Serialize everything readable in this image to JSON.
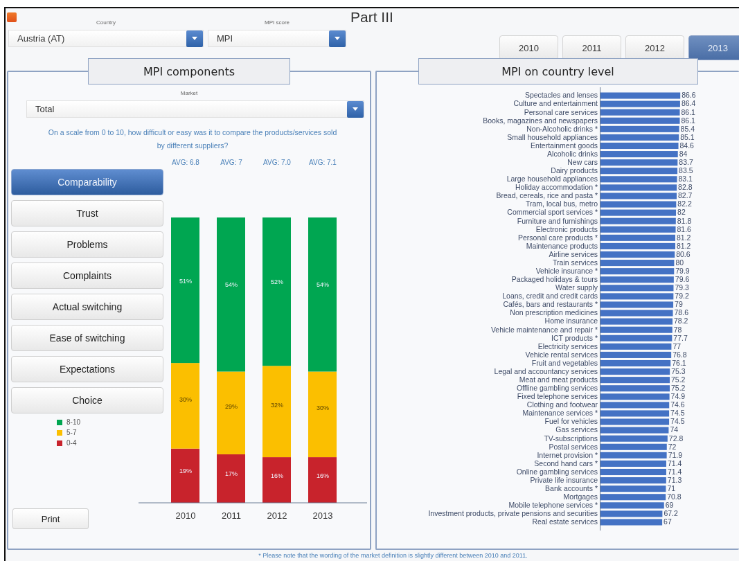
{
  "title": "Part III",
  "filters": [
    {
      "label": "Country",
      "value": "Austria (AT)"
    },
    {
      "label": "MPI score",
      "value": "MPI"
    }
  ],
  "years": [
    {
      "label": "2010",
      "selected": false
    },
    {
      "label": "2011",
      "selected": false
    },
    {
      "label": "2012",
      "selected": false
    },
    {
      "label": "2013",
      "selected": true
    }
  ],
  "components_panel": {
    "heading": "MPI components",
    "market_label": "Market",
    "market_value": "Total",
    "question": "On a scale from 0 to 10, how difficult or easy was it to compare the products/services sold by different suppliers?",
    "averages": [
      "AVG: 6.8",
      "AVG: 7",
      "AVG: 7.0",
      "AVG: 7.1"
    ],
    "components": [
      {
        "label": "Comparability",
        "selected": true
      },
      {
        "label": "Trust",
        "selected": false
      },
      {
        "label": "Problems",
        "selected": false
      },
      {
        "label": "Complaints",
        "selected": false
      },
      {
        "label": "Actual switching",
        "selected": false
      },
      {
        "label": "Ease of switching",
        "selected": false
      },
      {
        "label": "Expectations",
        "selected": false
      },
      {
        "label": "Choice",
        "selected": false
      }
    ],
    "chart_data": {
      "type": "bar",
      "stacked": true,
      "categories": [
        "2010",
        "2011",
        "2012",
        "2013"
      ],
      "data_labels": true,
      "series": [
        {
          "name": "0-4",
          "color": "#c8232c",
          "values": [
            19,
            17,
            16,
            16
          ],
          "value_labels": [
            "19%",
            "17%",
            "16%",
            "16%"
          ]
        },
        {
          "name": "5-7",
          "color": "#fbbf00",
          "values": [
            30,
            29,
            32,
            30
          ],
          "value_labels": [
            "30%",
            "29%",
            "32%",
            "30%"
          ]
        },
        {
          "name": "8-10",
          "color": "#00a651",
          "values": [
            51,
            54,
            52,
            54
          ],
          "value_labels": [
            "51%",
            "54%",
            "52%",
            "54%"
          ]
        }
      ]
    },
    "print_button": "Print"
  },
  "country_panel": {
    "heading": "MPI on country level",
    "chart_data": {
      "type": "bar",
      "orientation": "horizontal",
      "data_labels": true,
      "categories": [
        "Spectacles and lenses",
        "Culture and entertainment",
        "Personal care services",
        "Books, magazines and newspapers",
        "Non-Alcoholic drinks *",
        "Small household appliances",
        "Entertainment goods",
        "Alcoholic drinks",
        "New cars",
        "Dairy products",
        "Large household appliances",
        "Holiday accommodation *",
        "Bread, cereals, rice and pasta *",
        "Tram, local bus, metro",
        "Commercial sport services *",
        "Furniture and furnishings",
        "Electronic products",
        "Personal care products *",
        "Maintenance products",
        "Airline services",
        "Train services",
        "Vehicle insurance *",
        "Packaged holidays & tours",
        "Water supply",
        "Loans, credit and credit cards",
        "Cafés, bars and restaurants *",
        "Non prescription medicines",
        "Home insurance",
        "Vehicle maintenance and repair *",
        "ICT products *",
        "Electricity services",
        "Vehicle rental services",
        "Fruit and vegetables",
        "Legal and accountancy services",
        "Meat and meat products",
        "Offline gambling services",
        "Fixed telephone services",
        "Clothing and footwear",
        "Maintenance services *",
        "Fuel for vehicles",
        "Gas services",
        "TV-subscriptions",
        "Postal services",
        "Internet provision *",
        "Second hand cars *",
        "Online gambling services",
        "Private life insurance",
        "Bank accounts *",
        "Mortgages",
        "Mobile telephone services *",
        "Investment products, private pensions and securities",
        "Real estate services"
      ],
      "values": [
        86.6,
        86.4,
        86.1,
        86.1,
        85.4,
        85.1,
        84.6,
        84,
        83.7,
        83.5,
        83.1,
        82.8,
        82.7,
        82.2,
        82,
        81.8,
        81.6,
        81.2,
        81.2,
        80.6,
        80,
        79.9,
        79.6,
        79.3,
        79.2,
        79,
        78.6,
        78.2,
        78,
        77.7,
        77,
        76.8,
        76.1,
        75.3,
        75.2,
        75.2,
        74.9,
        74.6,
        74.5,
        74.5,
        74,
        72.8,
        72,
        71.9,
        71.4,
        71.4,
        71.3,
        71,
        70.8,
        69,
        67.2,
        67
      ]
    }
  },
  "footnote": "* Please note that the wording of the market definition is slightly different between 2010 and 2011."
}
